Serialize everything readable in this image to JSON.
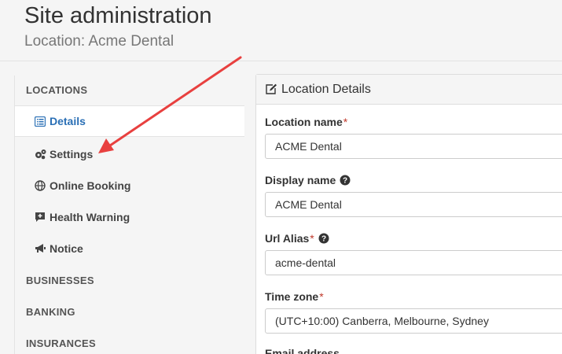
{
  "header": {
    "title": "Site administration",
    "subtitle": "Location: Acme Dental"
  },
  "sidebar": {
    "sections": [
      {
        "label": "LOCATIONS"
      },
      {
        "label": "BUSINESSES"
      },
      {
        "label": "BANKING"
      },
      {
        "label": "INSURANCES"
      }
    ],
    "items": [
      {
        "label": "Details",
        "icon": "list-icon",
        "active": true
      },
      {
        "label": "Settings",
        "icon": "gears-icon"
      },
      {
        "label": "Online Booking",
        "icon": "globe-icon"
      },
      {
        "label": "Health Warning",
        "icon": "medical-message-icon"
      },
      {
        "label": "Notice",
        "icon": "megaphone-icon"
      }
    ]
  },
  "panel": {
    "title": "Location Details",
    "title_icon": "edit-icon",
    "fields": {
      "location_name": {
        "label": "Location name",
        "required": "*",
        "value": "ACME Dental"
      },
      "display_name": {
        "label": "Display name",
        "value": "ACME Dental",
        "help_icon": "question-circle-icon"
      },
      "url_alias": {
        "label": "Url Alias",
        "required": "*",
        "value": "acme-dental",
        "help_icon": "question-circle-icon"
      },
      "time_zone": {
        "label": "Time zone",
        "required": "*",
        "value": "(UTC+10:00) Canberra, Melbourne, Sydney"
      },
      "email_address": {
        "label": "Email address"
      }
    }
  },
  "annotation": {
    "color": "#e8403f",
    "icon": "red-arrow"
  },
  "colors": {
    "accent": "#2a6fb5",
    "required": "#c0392b"
  }
}
